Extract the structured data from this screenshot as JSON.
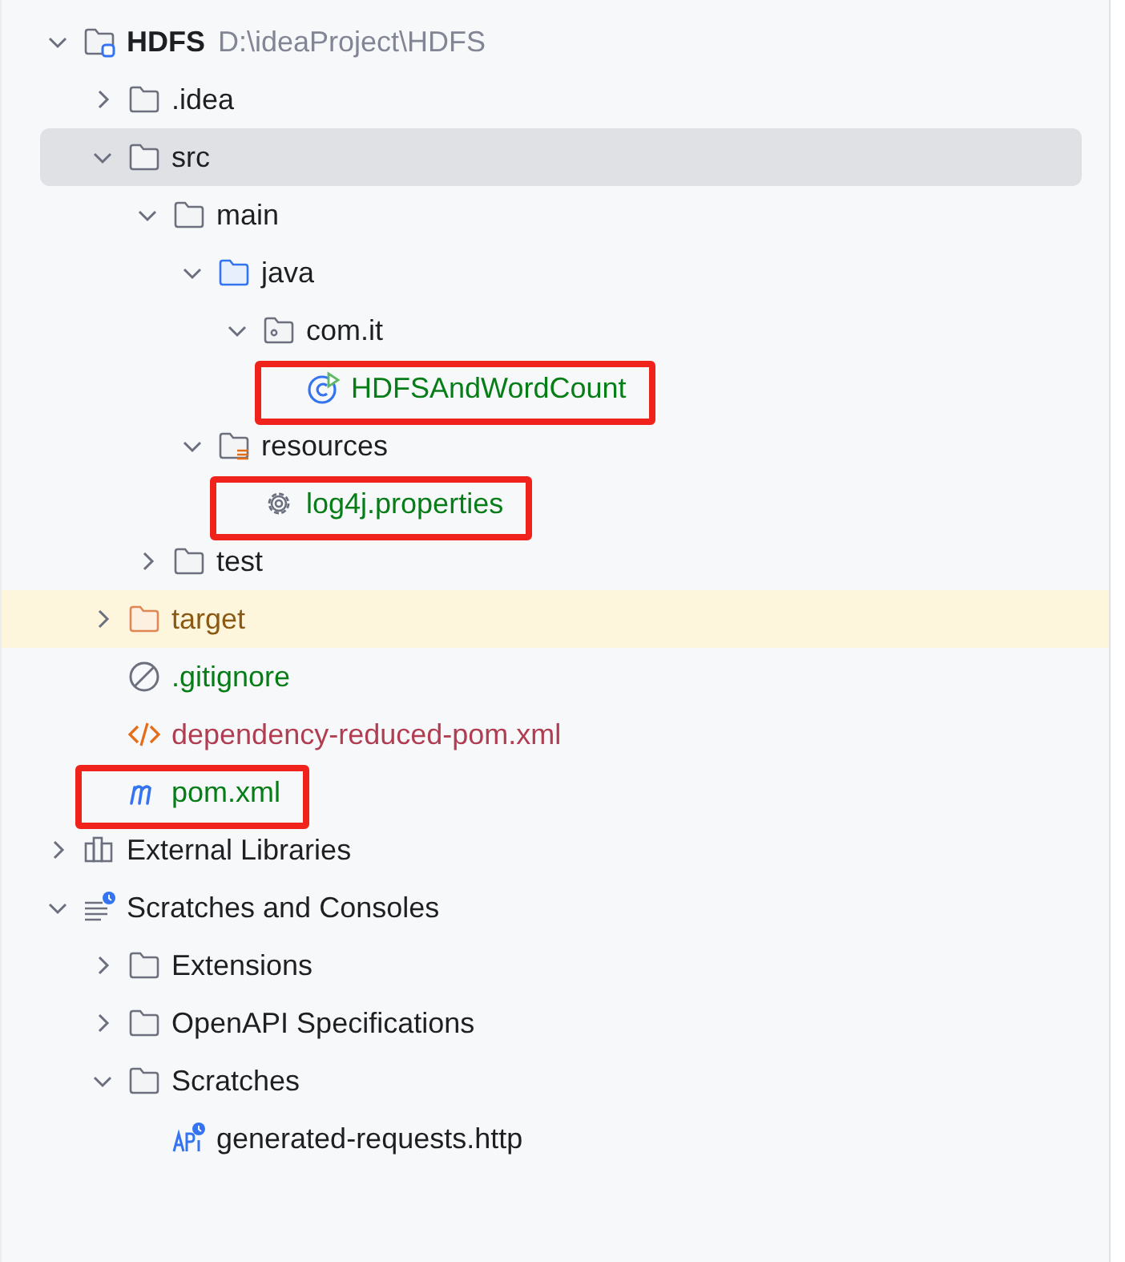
{
  "tree": [
    {
      "label": "HDFS",
      "path": "D:\\ideaProject\\HDFS",
      "kind": "project",
      "expanded": true,
      "selected": false,
      "children": [
        {
          "label": ".idea",
          "kind": "folder",
          "expanded": false,
          "selected": false
        },
        {
          "label": "src",
          "kind": "folder",
          "expanded": true,
          "selected": true,
          "children": [
            {
              "label": "main",
              "kind": "folder",
              "expanded": true,
              "selected": false,
              "children": [
                {
                  "label": "java",
                  "kind": "source-folder",
                  "expanded": true,
                  "selected": false,
                  "children": [
                    {
                      "label": "com.it",
                      "kind": "package",
                      "expanded": true,
                      "selected": false,
                      "children": [
                        {
                          "label": "HDFSAndWordCount",
                          "kind": "class",
                          "color": "#067d17",
                          "selected": false,
                          "annotated": true
                        }
                      ]
                    }
                  ]
                },
                {
                  "label": "resources",
                  "kind": "resources-folder",
                  "expanded": true,
                  "selected": false,
                  "children": [
                    {
                      "label": "log4j.properties",
                      "kind": "properties",
                      "color": "#067d17",
                      "selected": false,
                      "annotated": true
                    }
                  ]
                }
              ]
            },
            {
              "label": "test",
              "kind": "folder",
              "expanded": false,
              "selected": false
            }
          ]
        },
        {
          "label": "target",
          "kind": "excluded-folder",
          "color": "#8a5a13",
          "expanded": false,
          "selected": false
        },
        {
          "label": ".gitignore",
          "kind": "ignore",
          "color": "#067d17",
          "selected": false
        },
        {
          "label": "dependency-reduced-pom.xml",
          "kind": "xml",
          "color": "#b13d52",
          "selected": false
        },
        {
          "label": "pom.xml",
          "kind": "maven",
          "color": "#067d17",
          "selected": false,
          "annotated": true
        }
      ]
    },
    {
      "label": "External Libraries",
      "kind": "libraries",
      "expanded": false,
      "selected": false
    },
    {
      "label": "Scratches and Consoles",
      "kind": "scratches",
      "expanded": true,
      "selected": false,
      "children": [
        {
          "label": "Extensions",
          "kind": "folder",
          "expanded": false,
          "selected": false
        },
        {
          "label": "OpenAPI Specifications",
          "kind": "folder",
          "expanded": false,
          "selected": false
        },
        {
          "label": "Scratches",
          "kind": "folder",
          "expanded": true,
          "selected": false,
          "children": [
            {
              "label": "generated-requests.http",
              "kind": "http",
              "selected": false
            }
          ]
        }
      ]
    }
  ]
}
